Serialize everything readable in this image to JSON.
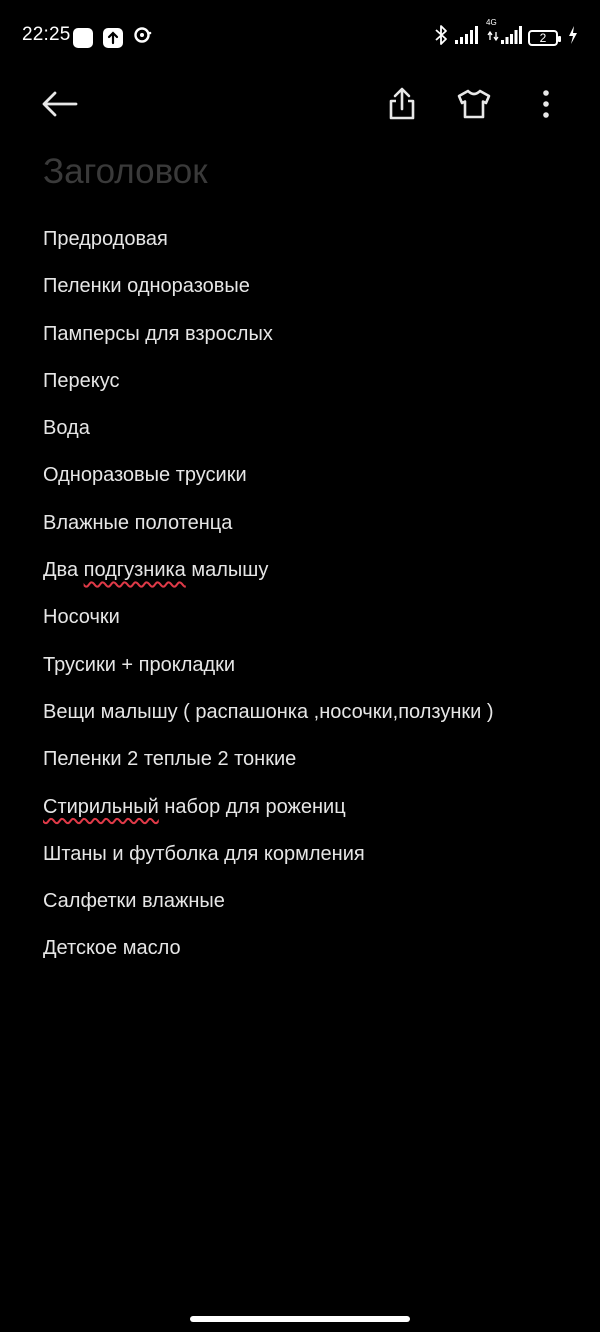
{
  "status_bar": {
    "time": "22:25",
    "network_type": "4G",
    "battery_level": "2",
    "left_icons": [
      "notification-square-icon",
      "upload-arrow-icon",
      "record-icon"
    ],
    "right_icons": [
      "bluetooth-icon",
      "signal-icon",
      "signal-4g-icon",
      "battery-icon",
      "charging-icon"
    ]
  },
  "toolbar": {
    "icons": [
      "back-arrow-icon",
      "share-icon",
      "tshirt-icon",
      "more-vertical-icon"
    ]
  },
  "note": {
    "title_placeholder": "Заголовок",
    "lines": [
      {
        "parts": [
          {
            "text": "Предродовая"
          }
        ]
      },
      {
        "parts": [
          {
            "text": "Пеленки одноразовые"
          }
        ]
      },
      {
        "parts": [
          {
            "text": "Памперсы для взрослых"
          }
        ]
      },
      {
        "parts": [
          {
            "text": "Перекус"
          }
        ]
      },
      {
        "parts": [
          {
            "text": "Вода"
          }
        ]
      },
      {
        "parts": [
          {
            "text": "Одноразовые трусики"
          }
        ]
      },
      {
        "parts": [
          {
            "text": "Влажные полотенца"
          }
        ]
      },
      {
        "parts": [
          {
            "text": "Два "
          },
          {
            "text": "подгузника",
            "misspelled": true
          },
          {
            "text": " малышу"
          }
        ]
      },
      {
        "parts": [
          {
            "text": "Носочки"
          }
        ]
      },
      {
        "parts": [
          {
            "text": "Трусики + прокладки"
          }
        ]
      },
      {
        "parts": [
          {
            "text": "Вещи малышу ( распашонка ,носочки,ползунки )"
          }
        ]
      },
      {
        "parts": [
          {
            "text": "Пеленки 2 теплые 2 тонкие"
          }
        ]
      },
      {
        "parts": [
          {
            "text": "Стирильный",
            "misspelled": true
          },
          {
            "text": " набор для рожениц"
          }
        ]
      },
      {
        "parts": [
          {
            "text": "Штаны и футболка для кормления"
          }
        ]
      },
      {
        "parts": [
          {
            "text": "Салфетки влажные"
          }
        ]
      },
      {
        "parts": [
          {
            "text": "Детское масло"
          }
        ]
      }
    ]
  },
  "colors": {
    "background": "#000000",
    "text": "#e6e6e6",
    "title_placeholder": "#3a3a3a",
    "spellcheck_underline": "#e03a48"
  }
}
